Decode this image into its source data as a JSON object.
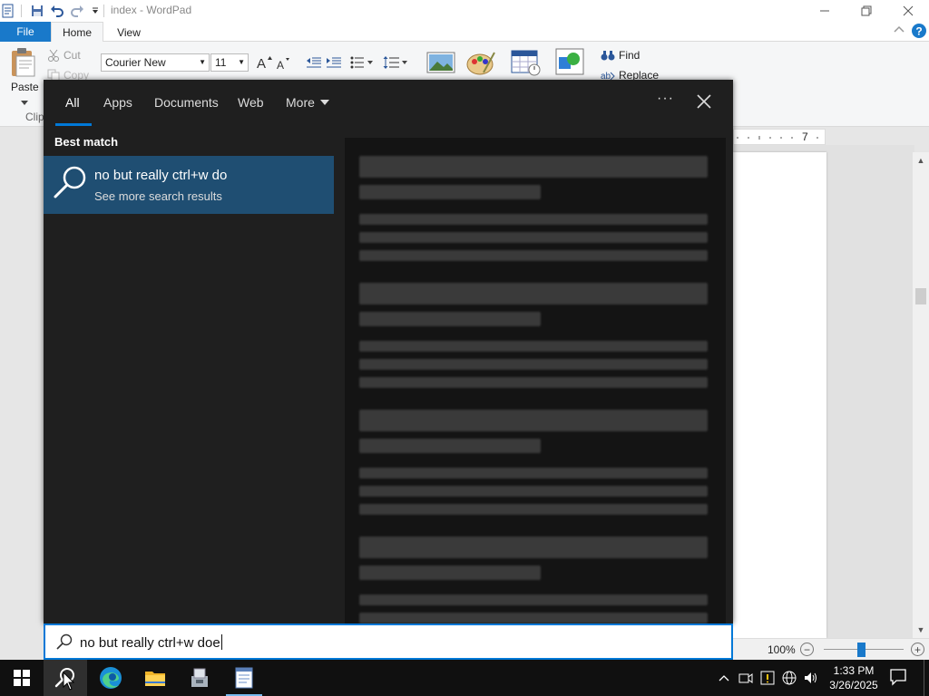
{
  "wordpad": {
    "title": "index - WordPad",
    "tabs": {
      "file": "File",
      "home": "Home",
      "view": "View"
    },
    "ribbon": {
      "paste": "Paste",
      "cut": "Cut",
      "copy": "Copy",
      "clipboard_group": "Clip",
      "font_name": "Courier New",
      "font_size": "11",
      "find": "Find",
      "replace": "Replace"
    },
    "ruler_number": "7",
    "zoom": "100%"
  },
  "search_panel": {
    "tabs": {
      "all": "All",
      "apps": "Apps",
      "documents": "Documents",
      "web": "Web",
      "more": "More"
    },
    "best_match_heading": "Best match",
    "best_match": {
      "title": "no but really ctrl+w do",
      "subtitle": "See more search results"
    },
    "query": "no but really ctrl+w doe"
  },
  "taskbar": {
    "time": "1:33 PM",
    "date": "3/26/2025"
  },
  "colors": {
    "accent": "#0078d7",
    "ribbon_file": "#1979ca",
    "result_highlight": "#1f4e72",
    "panel_bg": "#1f1f1f",
    "taskbar_bg": "#101010"
  }
}
